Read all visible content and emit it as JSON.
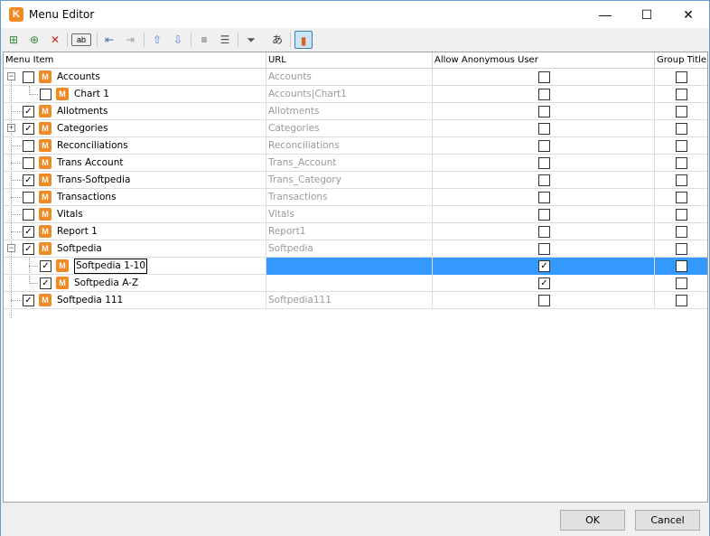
{
  "window": {
    "title": "Menu Editor",
    "icon_letter": "K",
    "minimize_glyph": "—",
    "maximize_glyph": "☐",
    "close_glyph": "✕"
  },
  "toolbar": {
    "add_item_glyph": "⊞",
    "add_child_glyph": "⊕",
    "delete_glyph": "✕",
    "rename_glyph": "ab",
    "outdent_glyph": "⇤",
    "indent_glyph": "⇥",
    "move_up_glyph": "⇧",
    "move_down_glyph": "⇩",
    "collapse_glyph": "≡",
    "expand_glyph": "☰",
    "filter_glyph": "⏷",
    "translate_glyph": "あ",
    "report_glyph": "▮"
  },
  "columns": {
    "menu_item": "Menu Item",
    "url": "URL",
    "anon": "Allow Anonymous User",
    "group": "Group Title"
  },
  "rows": [
    {
      "label": "Accounts",
      "url": "Accounts",
      "checked": "",
      "anon": "",
      "group": "",
      "expander": "−"
    },
    {
      "label": "Chart 1",
      "url": "Accounts|Chart1",
      "checked": "",
      "anon": "",
      "group": ""
    },
    {
      "label": "Allotments",
      "url": "Allotments",
      "checked": "✓",
      "anon": "",
      "group": ""
    },
    {
      "label": "Categories",
      "url": "Categories",
      "checked": "✓",
      "anon": "",
      "group": "",
      "expander": "+"
    },
    {
      "label": "Reconciliations",
      "url": "Reconciliations",
      "checked": "",
      "anon": "",
      "group": ""
    },
    {
      "label": "Trans Account",
      "url": "Trans_Account",
      "checked": "",
      "anon": "",
      "group": ""
    },
    {
      "label": "Trans-Softpedia",
      "url": "Trans_Category",
      "checked": "✓",
      "anon": "",
      "group": ""
    },
    {
      "label": "Transactions",
      "url": "Transactions",
      "checked": "",
      "anon": "",
      "group": ""
    },
    {
      "label": "Vitals",
      "url": "Vitals",
      "checked": "",
      "anon": "",
      "group": ""
    },
    {
      "label": "Report 1",
      "url": "Report1",
      "checked": "✓",
      "anon": "",
      "group": ""
    },
    {
      "label": "Softpedia",
      "url": "Softpedia",
      "checked": "✓",
      "anon": "",
      "group": "",
      "expander": "−"
    },
    {
      "label": "Softpedia 1-10",
      "url": "",
      "checked": "✓",
      "anon": "✓",
      "group": ""
    },
    {
      "label": "Softpedia A-Z",
      "url": "",
      "checked": "✓",
      "anon": "✓",
      "group": ""
    },
    {
      "label": "Softpedia 111",
      "url": "Softpedia111",
      "checked": "✓",
      "anon": "",
      "group": ""
    }
  ],
  "icon_letter_m": "M",
  "buttons": {
    "ok": "OK",
    "cancel": "Cancel"
  },
  "colors": {
    "accent": "#3399ff",
    "menu_icon": "#f08a24"
  }
}
